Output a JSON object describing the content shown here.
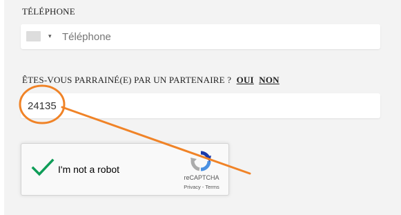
{
  "phone_field": {
    "label": "TÉLÉPHONE",
    "placeholder": "Téléphone",
    "country_flag": "blank-flag",
    "country_caret": "▾"
  },
  "referral": {
    "question": "ÊTES-VOUS PARRAINÉ(E) PAR UN PARTENAIRE ?",
    "yes_label": "OUI",
    "no_label": "NON",
    "code_value": "24135"
  },
  "recaptcha": {
    "label": "I'm not a robot",
    "checked": true,
    "brand": "reCAPTCHA",
    "privacy_label": "Privacy",
    "separator": " - ",
    "terms_label": "Terms"
  },
  "annotation": {
    "shape": "circle-with-arrow",
    "color": "#f08327"
  },
  "colors": {
    "panel_background": "#f3f3f3",
    "checkmark": "#0f9d58",
    "text": "#222222"
  }
}
